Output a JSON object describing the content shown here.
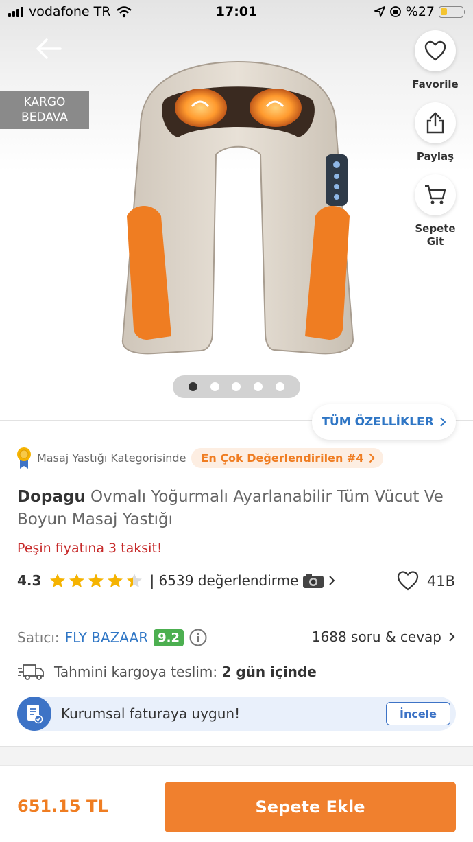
{
  "status_bar": {
    "carrier": "vodafone TR",
    "time": "17:01",
    "battery": "%27"
  },
  "hero": {
    "cargo_badge": [
      "KARGO",
      "BEDAVA"
    ],
    "side_buttons": [
      {
        "label": "Favorile",
        "icon": "heart-icon"
      },
      {
        "label": "Paylaş",
        "icon": "share-icon"
      },
      {
        "label": "Sepete Git",
        "icon": "cart-icon"
      }
    ],
    "carousel": {
      "total": 5,
      "active": 1
    }
  },
  "specs_button": "TÜM ÖZELLİKLER",
  "rank": {
    "category": "Masaj Yastığı Kategorisinde",
    "pill": "En Çok Değerlendirilen #4"
  },
  "product": {
    "brand": "Dopagu",
    "name": "Ovmalı Yoğurmalı Ayarlanabilir Tüm Vücut Ve Boyun Masaj Yastığı",
    "installment": "Peşin fiyatına 3 taksit!",
    "rating": "4.3",
    "rating_value": 4.3,
    "reviews": "| 6539 değerlendirme",
    "favorites": "41B"
  },
  "seller": {
    "label": "Satıcı:",
    "name": "FLY BAZAAR",
    "score": "9.2",
    "qa": "1688 soru & cevap"
  },
  "delivery": {
    "label": "Tahmini kargoya teslim:",
    "value": "2 gün içinde"
  },
  "corporate": {
    "text": "Kurumsal faturaya uygun!",
    "button": "İncele"
  },
  "bottom": {
    "price": "651.15 TL",
    "cta": "Sepete Ekle"
  },
  "colors": {
    "accent": "#f0802e",
    "link": "#2f76c5",
    "installment": "#c62828",
    "seller_score": "#4caf50",
    "star": "#f5b301"
  }
}
